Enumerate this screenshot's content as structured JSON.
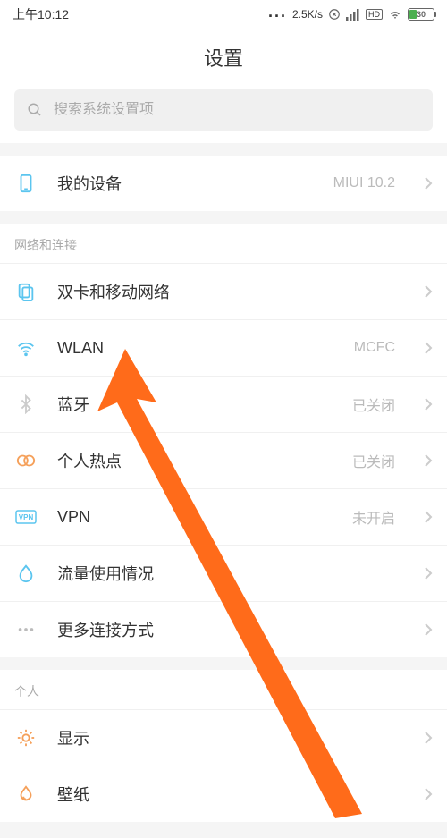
{
  "status_bar": {
    "time": "上午10:12",
    "speed": "2.5K/s",
    "hd_label": "HD",
    "battery": "30"
  },
  "title": "设置",
  "search": {
    "placeholder": "搜索系统设置项"
  },
  "my_device": {
    "label": "我的设备",
    "value": "MIUI 10.2"
  },
  "section_network": {
    "header": "网络和连接",
    "items": [
      {
        "label": "双卡和移动网络",
        "value": ""
      },
      {
        "label": "WLAN",
        "value": "MCFC"
      },
      {
        "label": "蓝牙",
        "value": "已关闭"
      },
      {
        "label": "个人热点",
        "value": "已关闭"
      },
      {
        "label": "VPN",
        "value": "未开启"
      },
      {
        "label": "流量使用情况",
        "value": ""
      },
      {
        "label": "更多连接方式",
        "value": ""
      }
    ]
  },
  "section_personal": {
    "header": "个人",
    "items": [
      {
        "label": "显示",
        "value": ""
      },
      {
        "label": "壁纸",
        "value": ""
      }
    ]
  }
}
